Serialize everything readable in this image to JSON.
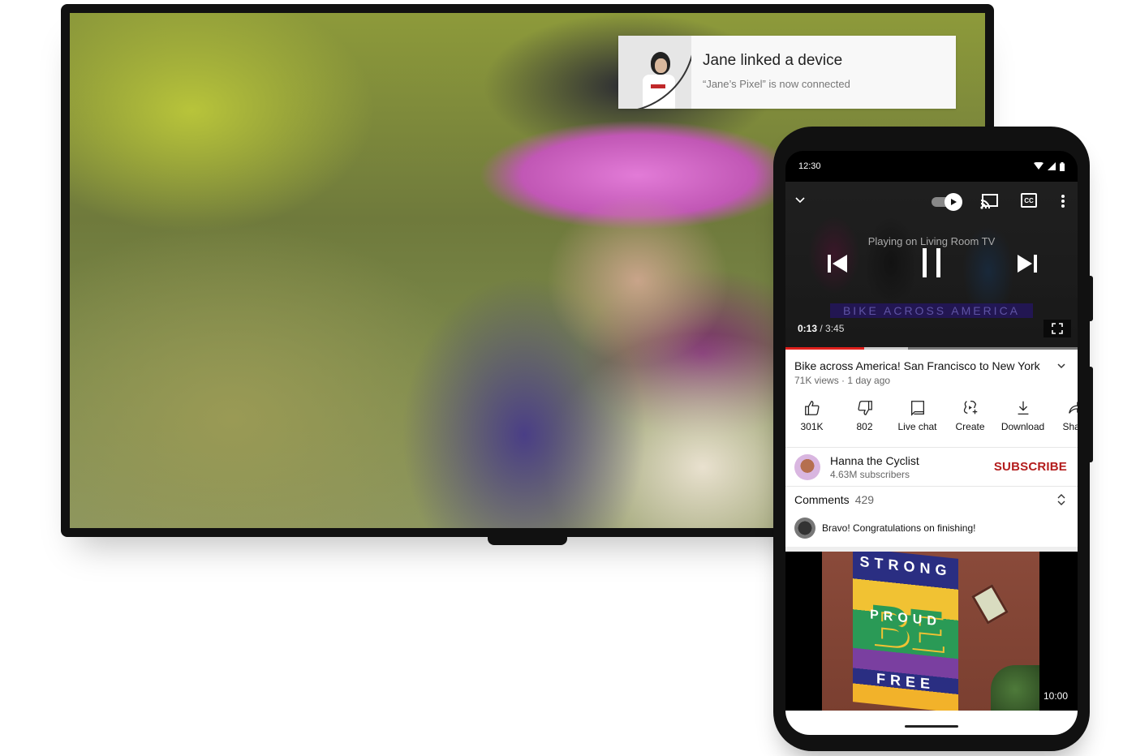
{
  "notification": {
    "title": "Jane linked a device",
    "subtitle": "“Jane’s Pixel” is now connected"
  },
  "phone": {
    "status_bar": {
      "time": "12:30",
      "icons": [
        "wifi-icon",
        "signal-icon",
        "battery-icon"
      ]
    },
    "player": {
      "cast_status": "Playing on Living Room TV",
      "video_banner": "BIKE ACROSS AMERICA",
      "current_time": "0:13",
      "duration": "3:45",
      "separator": " / ",
      "progress": 0.27,
      "buffered": 0.42,
      "cc_label": "CC",
      "autoplay_on": true
    },
    "video": {
      "title": "Bike across America! San Francisco to New York",
      "meta": "71K views · 1 day ago"
    },
    "actions": [
      {
        "icon": "thumbs-up-icon",
        "label": "301K"
      },
      {
        "icon": "thumbs-down-icon",
        "label": "802"
      },
      {
        "icon": "live-chat-icon",
        "label": "Live chat"
      },
      {
        "icon": "create-icon",
        "label": "Create"
      },
      {
        "icon": "download-icon",
        "label": "Download"
      },
      {
        "icon": "share-icon",
        "label": "Share"
      }
    ],
    "channel": {
      "name": "Hanna the Cyclist",
      "subscribers": "4.63M subscribers",
      "subscribe_label": "SUBSCRIBE"
    },
    "comments": {
      "label": "Comments",
      "count": "429",
      "top_comment": "Bravo! Congratulations on finishing!"
    },
    "next_video": {
      "duration": "10:00",
      "mural_words": [
        "STRONG",
        "BE",
        "PROUD",
        "FREE"
      ]
    }
  },
  "colors": {
    "accent_red": "#e0201c",
    "subscribe_red": "#b31c1c"
  }
}
